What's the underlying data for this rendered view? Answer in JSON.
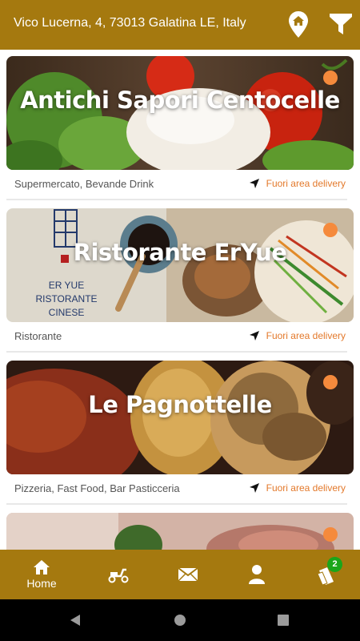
{
  "header": {
    "address": "Vico Lucerna, 4, 73013 Galatina LE, Italy",
    "location_icon": "location-pin-icon",
    "filter_icon": "filter-icon"
  },
  "restaurants": [
    {
      "name": "Antichi Sapori Centocelle",
      "categories": "Supermercato, Bevande Drink",
      "delivery_status": "Fuori area delivery",
      "status_color": "#f58a3c"
    },
    {
      "name": "Ristorante ErYue",
      "categories": "Ristorante",
      "delivery_status": "Fuori area delivery",
      "status_color": "#f58a3c",
      "logo_text_line1": "ER YUE",
      "logo_text_line2": "RISTORANTE CINESE"
    },
    {
      "name": "Le Pagnottelle",
      "categories": "Pizzeria, Fast Food, Bar Pasticceria",
      "delivery_status": "Fuori area delivery",
      "status_color": "#f58a3c"
    }
  ],
  "bottom_nav": {
    "home_label": "Home",
    "items": [
      "home-icon",
      "scooter-icon",
      "mail-icon",
      "user-icon",
      "cart-icon"
    ],
    "cart_badge": "2"
  },
  "colors": {
    "brand": "#a5790f",
    "accent": "#e3792b",
    "badge": "#1aa61a"
  }
}
